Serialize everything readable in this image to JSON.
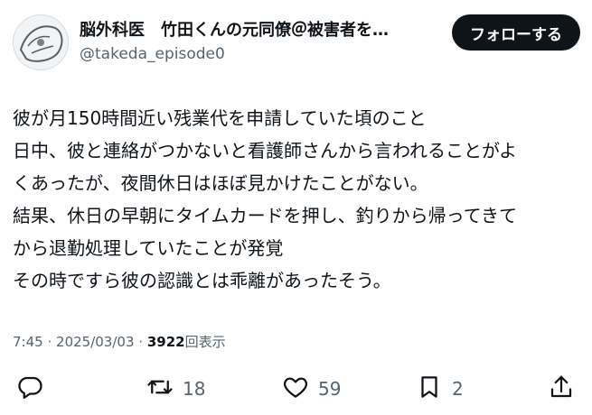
{
  "author": {
    "display_name": "脳外科医　竹田くんの元同僚＠被害者を…",
    "handle": "@takeda_episode0"
  },
  "follow_button": {
    "label": "フォローする"
  },
  "tweet": {
    "lines": [
      "彼が月150時間近い残業代を申請していた頃のこと",
      "日中、彼と連絡がつかないと看護師さんから言われることがよ",
      "くあったが、夜間休日はほぼ見かけたことがない。",
      "結果、休日の早朝にタイムカードを押し、釣りから帰ってきて",
      "から退勤処理していたことが発覚",
      "その時ですら彼の認識とは乖離があったそう。"
    ]
  },
  "meta": {
    "time": "7:45",
    "separator": "·",
    "date": "2025/03/03",
    "views_count": "3922",
    "views_label": "回表示"
  },
  "actions": {
    "reply": {
      "icon": "reply-icon"
    },
    "retweet": {
      "icon": "retweet-icon",
      "count": "18"
    },
    "like": {
      "icon": "heart-icon",
      "count": "59"
    },
    "bookmark": {
      "icon": "bookmark-icon",
      "count": "2"
    },
    "share": {
      "icon": "share-icon"
    }
  },
  "colors": {
    "text": "#0f1419",
    "secondary": "#536471",
    "button_bg": "#0f1419",
    "button_text": "#ffffff"
  }
}
